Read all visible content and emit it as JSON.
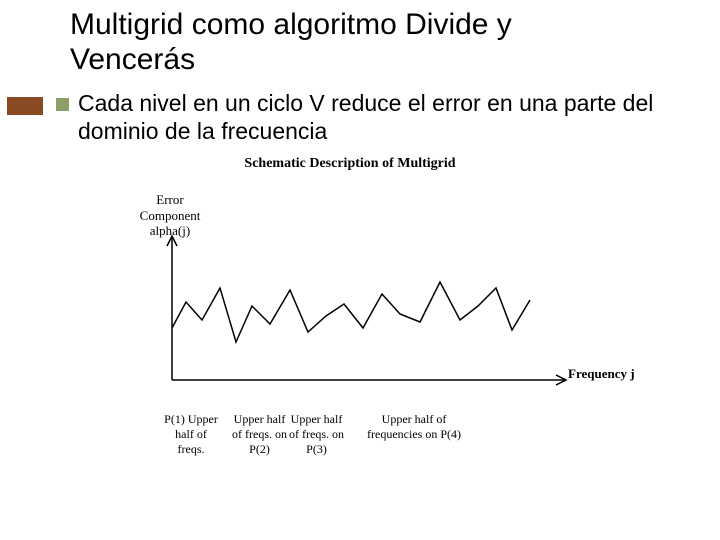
{
  "title": "Multigrid como algoritmo Divide y Vencerás",
  "body": "Cada nivel en un ciclo V reduce el error en una parte del dominio de la frecuencia",
  "figure": {
    "title": "Schematic Description of Multigrid",
    "ylabel": "Error\nComponent\nalpha(j)",
    "xlabel": "Frequency j"
  },
  "freq_groups": {
    "g1": "P(1) Upper half of freqs.",
    "g2": "Upper half of freqs. on P(2)",
    "g3": "Upper half of freqs. on P(3)",
    "g4": "Upper half of frequencies on P(4)"
  },
  "chart_data": {
    "type": "line",
    "title": "Schematic Description of Multigrid",
    "xlabel": "Frequency j",
    "ylabel": "Error Component alpha(j)",
    "xlim": [
      0,
      100
    ],
    "ylim": [
      0,
      100
    ],
    "series": [
      {
        "name": "alpha(j)",
        "x": [
          0,
          5,
          10,
          15,
          20,
          25,
          30,
          35,
          40,
          45,
          50,
          55,
          60,
          65,
          70,
          75,
          80,
          85,
          90,
          95,
          100
        ],
        "y": [
          42,
          63,
          48,
          76,
          30,
          60,
          45,
          72,
          38,
          50,
          60,
          40,
          70,
          52,
          44,
          78,
          46,
          58,
          74,
          40,
          64
        ]
      }
    ],
    "partitions": [
      {
        "label": "P(1) upper half",
        "from": 0,
        "to": 12.5
      },
      {
        "label": "P(2) upper half",
        "from": 12.5,
        "to": 25
      },
      {
        "label": "P(3) upper half",
        "from": 25,
        "to": 37.5
      },
      {
        "label": "P(4) upper half",
        "from": 37.5,
        "to": 62.5
      }
    ]
  }
}
